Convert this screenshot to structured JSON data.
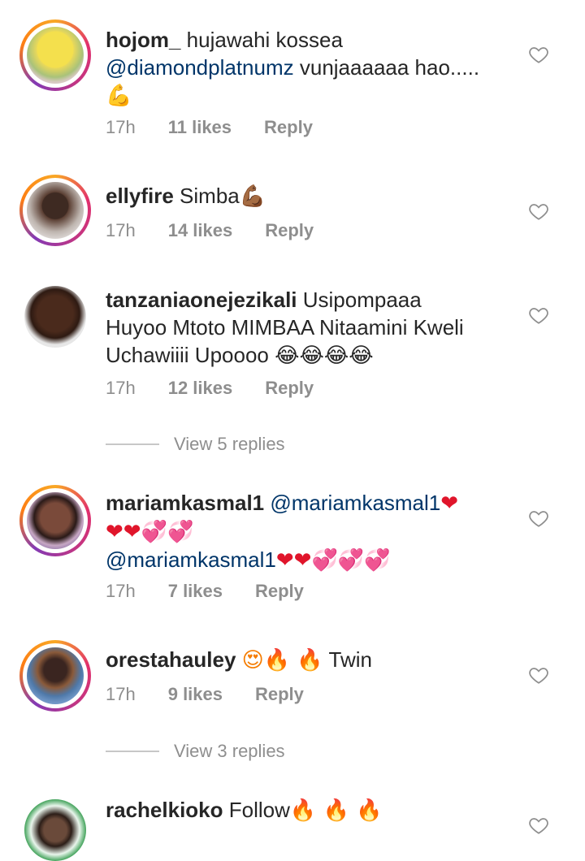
{
  "comments": [
    {
      "username": "hojom_",
      "text_before": " hujawahi kossea",
      "mention": "@diamondplatnumz",
      "text_after": "  vunjaaaaaa hao.....",
      "emoji": "💪",
      "time": "17h",
      "likes": "11 likes",
      "reply": "Reply",
      "avatar": "avatar-yellow-shirt",
      "ring": true
    },
    {
      "username": "ellyfire",
      "text": " Simba",
      "emoji": "💪🏾",
      "time": "17h",
      "likes": "14 likes",
      "reply": "Reply",
      "avatar": "avatar-man-tattoo",
      "ring": true
    },
    {
      "username": "tanzaniaonejezikali",
      "text_l1": " Usipompaaa",
      "text_l2": "Huyoo Mtoto MIMBAA Nitaamini Kweli",
      "text_l3": "Uchawiiii Upoooo ",
      "emoji": "😂😂😂😂",
      "time": "17h",
      "likes": "12 likes",
      "reply": "Reply",
      "avatar": "avatar-smiling-man",
      "ring": false
    },
    {
      "username": "mariamkasmal1",
      "mention": "@mariamkasmal1",
      "emoji_1": "❤",
      "emoji_2": "❤❤💞💞",
      "mention_2": "@mariamkasmal1",
      "emoji_3": "❤❤💞💞💞",
      "time": "17h",
      "likes": "7 likes",
      "reply": "Reply",
      "avatar": "avatar-woman-pink",
      "ring": true
    },
    {
      "username": "orestahauley",
      "emoji": "😍🔥 🔥",
      "text": "Twin",
      "time": "17h",
      "likes": "9 likes",
      "reply": "Reply",
      "avatar": "avatar-woman-blue",
      "ring": true
    },
    {
      "username": "rachelkioko",
      "text": " Follow",
      "emoji": "🔥 🔥 🔥",
      "avatar": "avatar-girl-green",
      "ring": false
    }
  ],
  "view_replies": [
    "View 5 replies",
    "View 3 replies"
  ],
  "colors": {
    "mention": "#003569",
    "meta": "#8e8e8e",
    "text": "#262626"
  },
  "icons": {
    "like": "heart-outline-icon"
  }
}
